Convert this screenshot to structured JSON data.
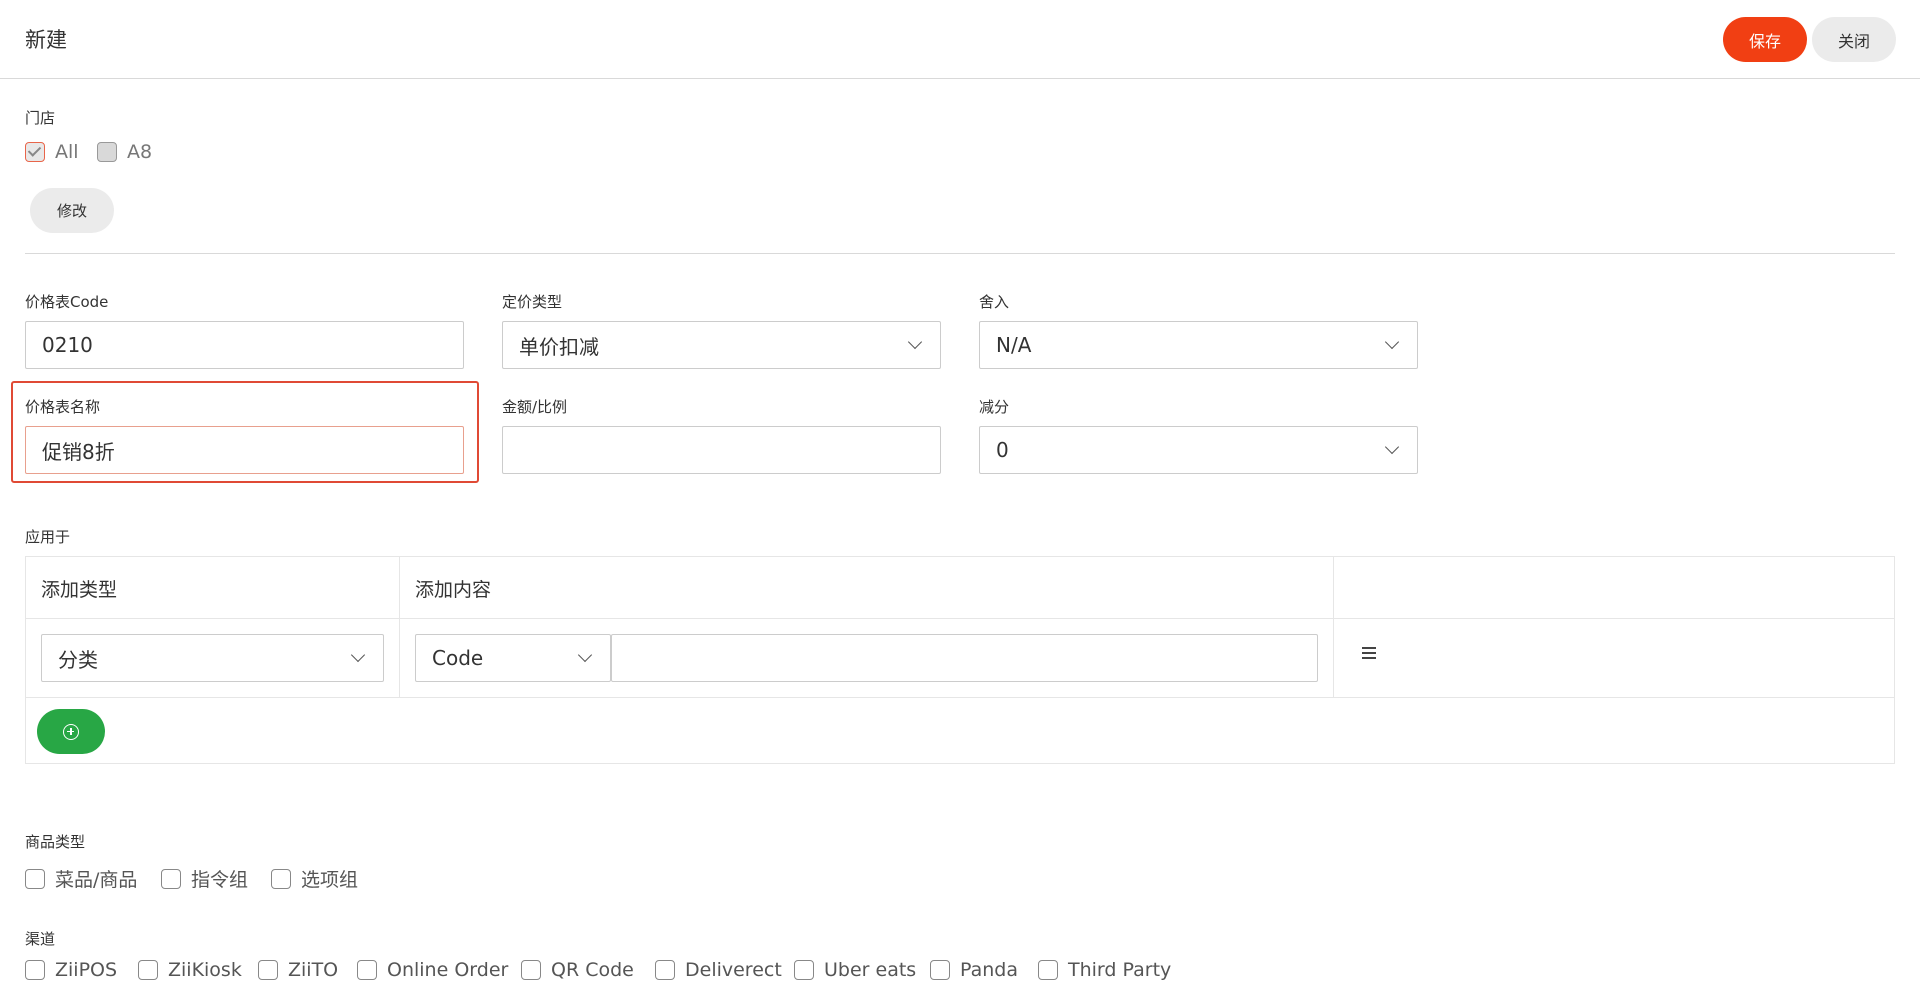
{
  "header": {
    "title": "新建",
    "save_label": "保存",
    "close_label": "关闭"
  },
  "store": {
    "label": "门店",
    "options": [
      {
        "label": "All",
        "checked": true
      },
      {
        "label": "A8",
        "checked": false
      }
    ],
    "edit_label": "修改"
  },
  "form": {
    "code_label": "价格表Code",
    "code_value": "0210",
    "pricing_type_label": "定价类型",
    "pricing_type_value": "单价扣减",
    "rounding_label": "舍入",
    "rounding_value": "N/A",
    "name_label": "价格表名称",
    "name_value": "促销8折",
    "amount_label": "金额/比例",
    "amount_value": "",
    "deduct_label": "减分",
    "deduct_value": "0"
  },
  "apply": {
    "label": "应用于",
    "col_type": "添加类型",
    "col_content": "添加内容",
    "row": {
      "type_value": "分类",
      "content_mode": "Code",
      "content_value": ""
    }
  },
  "product_type": {
    "label": "商品类型",
    "options": [
      "菜品/商品",
      "指令组",
      "选项组"
    ]
  },
  "channel": {
    "label": "渠道",
    "options": [
      "ZiiPOS",
      "ZiiKiosk",
      "ZiiTO",
      "Online Order",
      "QR Code",
      "Deliverect",
      "Uber eats",
      "Panda",
      "Third Party"
    ]
  },
  "colors": {
    "accent": "#f13f13",
    "add_button": "#28a745",
    "highlight": "#e04a35"
  }
}
